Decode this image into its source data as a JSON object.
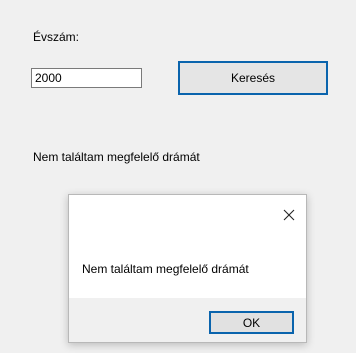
{
  "form": {
    "year_label": "Évszám:",
    "year_value": "2000",
    "search_label": "Keresés",
    "result_text": "Nem találtam megfelelő drámát"
  },
  "dialog": {
    "message": "Nem találtam megfelelő drámát",
    "ok_label": "OK",
    "close_icon": "close-icon"
  },
  "colors": {
    "window_background": "#f0f0f0",
    "accent_border": "#0a64ad",
    "dialog_background": "#ffffff"
  }
}
